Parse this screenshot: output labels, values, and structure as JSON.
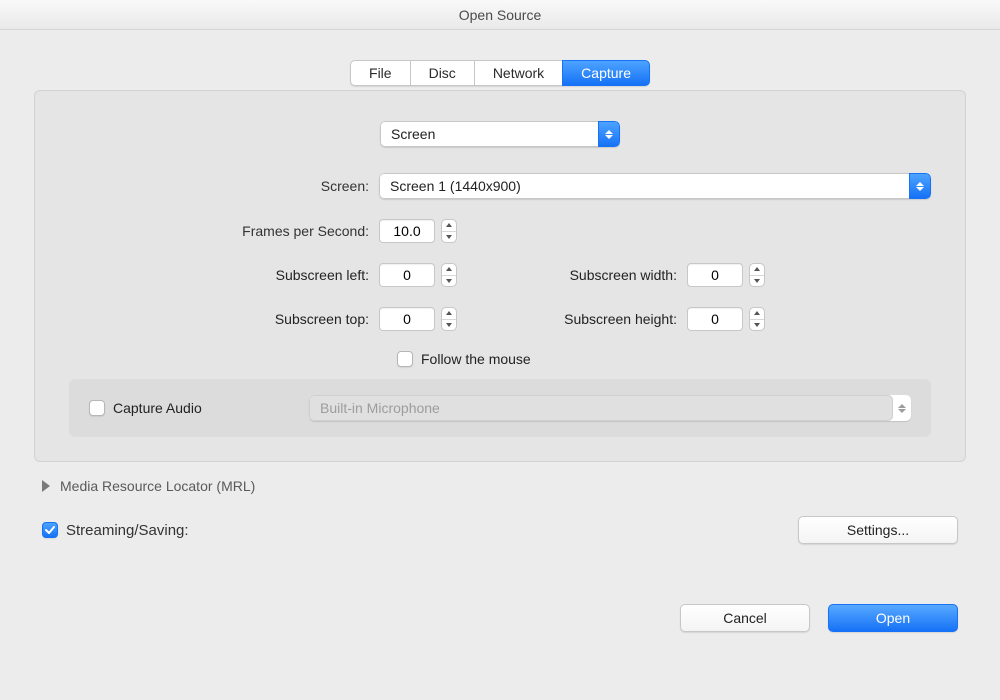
{
  "window": {
    "title": "Open Source"
  },
  "tabs": {
    "file": "File",
    "disc": "Disc",
    "network": "Network",
    "capture": "Capture"
  },
  "capture": {
    "source_type": "Screen",
    "screen_label": "Screen:",
    "screen_value": "Screen 1 (1440x900)",
    "fps_label": "Frames per Second:",
    "fps_value": "10.0",
    "sub_left_label": "Subscreen left:",
    "sub_left_value": "0",
    "sub_top_label": "Subscreen top:",
    "sub_top_value": "0",
    "sub_width_label": "Subscreen width:",
    "sub_width_value": "0",
    "sub_height_label": "Subscreen height:",
    "sub_height_value": "0",
    "follow_mouse_label": "Follow the mouse",
    "capture_audio_label": "Capture Audio",
    "audio_device": "Built-in Microphone"
  },
  "mrl_label": "Media Resource Locator (MRL)",
  "streaming_saving_label": "Streaming/Saving:",
  "settings_button": "Settings...",
  "cancel_button": "Cancel",
  "open_button": "Open"
}
